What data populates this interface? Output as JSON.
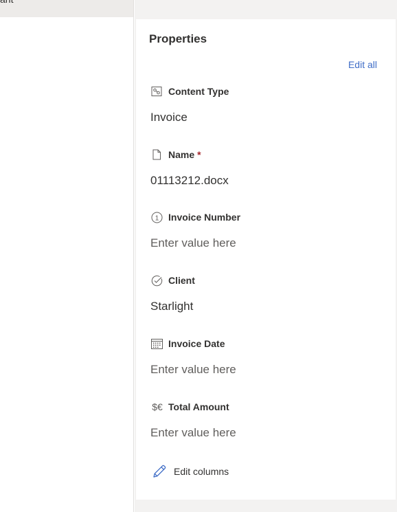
{
  "left_pane": {
    "truncated_item_label": "ant"
  },
  "properties": {
    "title": "Properties",
    "edit_all_label": "Edit all",
    "fields": [
      {
        "label": "Content Type",
        "icon": "content-type-icon",
        "value": "Invoice",
        "required": false,
        "is_placeholder": false
      },
      {
        "label": "Name",
        "icon": "document-icon",
        "value": "01113212.docx",
        "required": true,
        "is_placeholder": false
      },
      {
        "label": "Invoice Number",
        "icon": "number-circle-icon",
        "value": "Enter value here",
        "required": false,
        "is_placeholder": true
      },
      {
        "label": "Client",
        "icon": "check-circle-icon",
        "value": "Starlight",
        "required": false,
        "is_placeholder": false
      },
      {
        "label": "Invoice Date",
        "icon": "calendar-icon",
        "value": "Enter value here",
        "required": false,
        "is_placeholder": true
      },
      {
        "label": "Total Amount",
        "icon": "currency-icon",
        "value": "Enter value here",
        "required": false,
        "is_placeholder": true
      }
    ],
    "required_marker": "*",
    "number_icon_glyph": "1",
    "currency_icon_glyph": "$€",
    "edit_columns_label": "Edit columns"
  },
  "colors": {
    "accent_link": "#3f6dc7",
    "required": "#a4262c",
    "text_primary": "#323130",
    "text_placeholder": "#605e5c",
    "panel_background": "#f3f2f1"
  }
}
